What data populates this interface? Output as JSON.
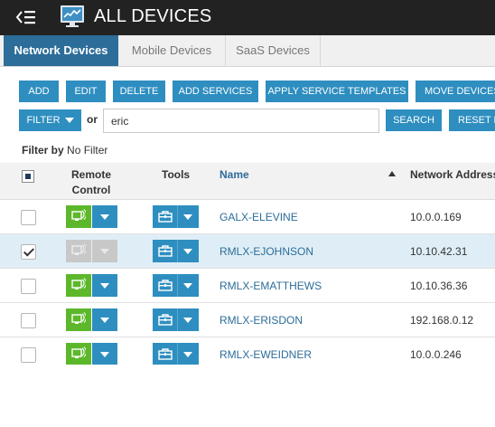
{
  "header": {
    "title": "ALL DEVICES",
    "menu_icon": "menu-collapse-icon",
    "app_icon": "monitor-icon"
  },
  "tabs": [
    {
      "label": "Network Devices",
      "active": true
    },
    {
      "label": "Mobile Devices",
      "active": false
    },
    {
      "label": "SaaS Devices",
      "active": false
    }
  ],
  "toolbar": {
    "add": "ADD",
    "edit": "EDIT",
    "delete": "DELETE",
    "add_services": "ADD SERVICES",
    "apply_templates": "APPLY SERVICE TEMPLATES",
    "move_devices": "MOVE DEVICES"
  },
  "search": {
    "filter_label": "FILTER",
    "or_label": "or",
    "query": "eric",
    "search_label": "SEARCH",
    "reset_label": "RESET FILTER"
  },
  "filter_by": {
    "label": "Filter by",
    "value": "No Filter"
  },
  "table": {
    "columns": {
      "remote_control_line1": "Remote",
      "remote_control_line2": "Control",
      "tools": "Tools",
      "name": "Name",
      "address": "Network Address"
    },
    "rows": [
      {
        "name": "GALX-ELEVINE",
        "address": "10.0.0.169",
        "checked": false,
        "remote_enabled": true
      },
      {
        "name": "RMLX-EJOHNSON",
        "address": "10.10.42.31",
        "checked": true,
        "remote_enabled": false
      },
      {
        "name": "RMLX-EMATTHEWS",
        "address": "10.10.36.36",
        "checked": false,
        "remote_enabled": true
      },
      {
        "name": "RMLX-ERISDON",
        "address": "192.168.0.12",
        "checked": false,
        "remote_enabled": true
      },
      {
        "name": "RMLX-EWEIDNER",
        "address": "10.0.0.246",
        "checked": false,
        "remote_enabled": true
      }
    ]
  },
  "colors": {
    "accent_blue": "#2e8ec0",
    "tab_active": "#2c6d99",
    "remote_green": "#5cb82a",
    "header_dark": "#222222",
    "selected_row": "#dfeef6"
  }
}
